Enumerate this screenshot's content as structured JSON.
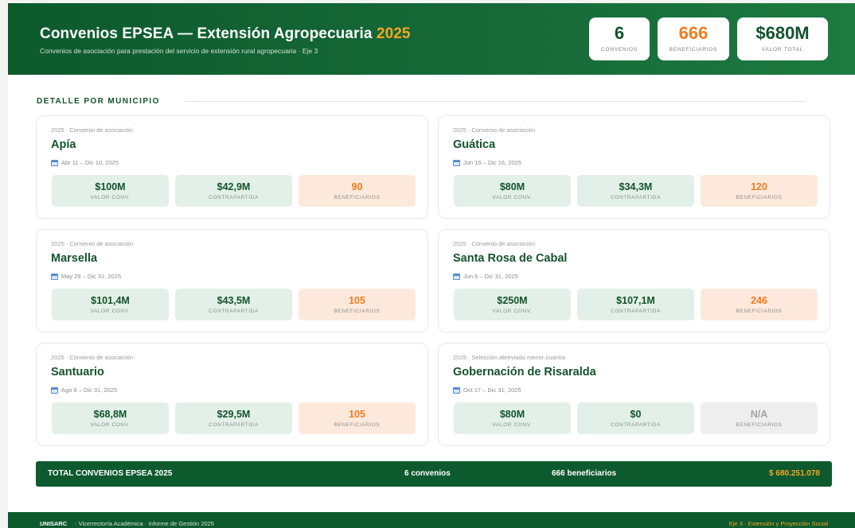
{
  "header": {
    "title": "Convenios EPSEA — Extensión Agropecuaria",
    "year": "2025",
    "subtitle": "Convenios de asociación para prestación del servicio de extensión rural agropecuaria · Eje 3",
    "kpis": [
      {
        "value": "6",
        "label": "CONVENIOS"
      },
      {
        "value": "666",
        "label": "BENEFICIARIOS"
      },
      {
        "value": "$680M",
        "label": "VALOR TOTAL"
      }
    ]
  },
  "section": {
    "title": "DETALLE POR MUNICIPIO"
  },
  "cards": [
    {
      "tag": "2025 · Convenio de asociación",
      "name": "Apía",
      "date": "Abr 11 – Dic 10, 2025",
      "valor": "$100M",
      "valor_label": "VALOR CONV.",
      "contra": "$42,9M",
      "contra_label": "CONTRAPARTIDA",
      "benef": "90",
      "benef_label": "BENEFICIARIOS"
    },
    {
      "tag": "2025 · Convenio de asociación",
      "name": "Guática",
      "date": "Jun 16 – Dic 16, 2025",
      "valor": "$80M",
      "valor_label": "VALOR CONV.",
      "contra": "$34,3M",
      "contra_label": "CONTRAPARTIDA",
      "benef": "120",
      "benef_label": "BENEFICIARIOS"
    },
    {
      "tag": "2025 · Convenio de asociación",
      "name": "Marsella",
      "date": "May 29 – Dic 31, 2025",
      "valor": "$101,4M",
      "valor_label": "VALOR CONV.",
      "contra": "$43,5M",
      "contra_label": "CONTRAPARTIDA",
      "benef": "105",
      "benef_label": "BENEFICIARIOS"
    },
    {
      "tag": "2025 · Convenio de asociación",
      "name": "Santa Rosa de Cabal",
      "date": "Jun 6 – Dic 31, 2025",
      "valor": "$250M",
      "valor_label": "VALOR CONV.",
      "contra": "$107,1M",
      "contra_label": "CONTRAPARTIDA",
      "benef": "246",
      "benef_label": "BENEFICIARIOS"
    },
    {
      "tag": "2025 · Convenio de asociación",
      "name": "Santuario",
      "date": "Ago 8 – Dic 31, 2025",
      "valor": "$68,8M",
      "valor_label": "VALOR CONV.",
      "contra": "$29,5M",
      "contra_label": "CONTRAPARTIDA",
      "benef": "105",
      "benef_label": "BENEFICIARIOS"
    },
    {
      "tag": "2025 · Selección abreviada menor cuantía",
      "name": "Gobernación de Risaralda",
      "date": "Oct 17 – Dic 31, 2025",
      "valor": "$80M",
      "valor_label": "VALOR CONV.",
      "contra": "$0",
      "contra_label": "CONTRAPARTIDA",
      "benef": "N/A",
      "benef_label": "BENEFICIARIOS"
    }
  ],
  "total": {
    "label": "TOTAL CONVENIOS EPSEA 2025",
    "convenios": "6 convenios",
    "beneficiarios": "666 beneficiarios",
    "amount": "$ 680.251.078"
  },
  "footer": {
    "brand": "UNISARC",
    "text": "· Vicerrectoría Académica · Informe de Gestión 2025",
    "right": "Eje 3 · Extensión y Proyección Social"
  },
  "colors": {
    "primary_green": "#13532c",
    "accent_orange": "#f07c1e",
    "gold": "#f5a623"
  }
}
